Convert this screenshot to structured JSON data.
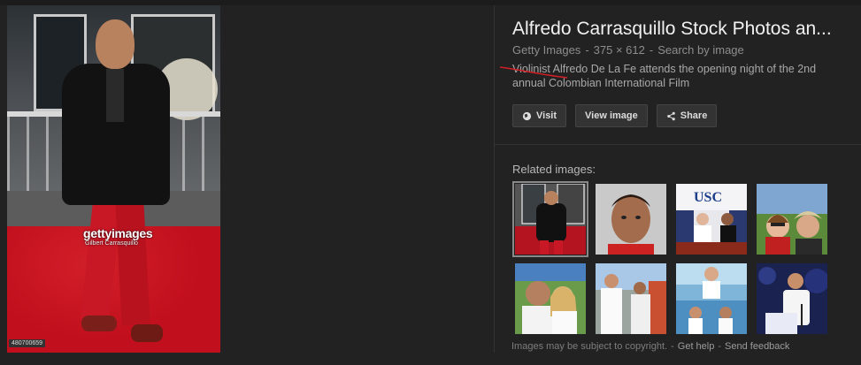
{
  "result": {
    "title": "Alfredo Carrasquillo Stock Photos an...",
    "source": "Getty Images",
    "dimensions": "375 × 612",
    "search_by_image": "Search by image",
    "description": "Violinist Alfredo De La Fe attends the opening night of the 2nd annual Colombian International Film"
  },
  "photo": {
    "watermark": "gettyimages",
    "credit": "Gilbert Carrasquillo",
    "image_id": "480700659"
  },
  "actions": {
    "visit": "Visit",
    "view_image": "View image",
    "share": "Share"
  },
  "related": {
    "label": "Related images:"
  },
  "footer": {
    "copyright": "Images may be subject to copyright.",
    "help": "Get help",
    "feedback": "Send feedback"
  },
  "colors": {
    "background": "#222222",
    "annotation": "#d01f25"
  }
}
